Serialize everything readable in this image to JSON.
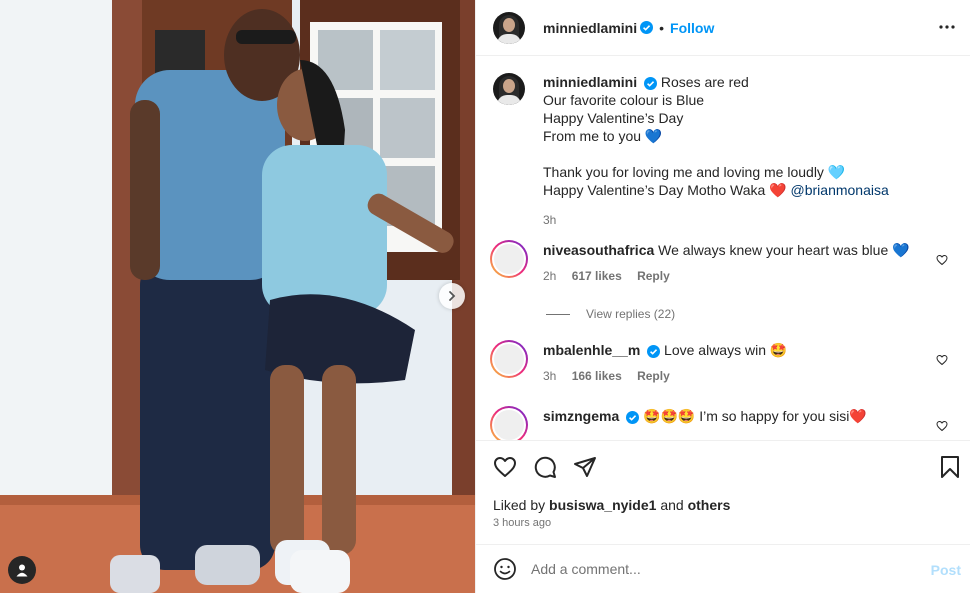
{
  "post": {
    "username": "minniedlamini",
    "follow_label": "Follow",
    "separator": "•",
    "more_icon": "more-horizontal-icon"
  },
  "caption": {
    "username": "minniedlamini",
    "lines": [
      "Roses are red",
      "Our favorite colour is Blue",
      "Happy Valentine’s Day",
      "From me to you 💙",
      "",
      "Thank you for loving me and loving me loudly 🩵",
      "Happy Valentine’s Day Motho Waka ❤️"
    ],
    "mention": "@brianmonaisa",
    "time": "3h"
  },
  "comments": [
    {
      "username": "niveasouthafrica",
      "text": "We always knew your heart was blue 💙",
      "time": "2h",
      "likes": "617 likes",
      "reply_label": "Reply"
    },
    {
      "username": "mbalenhle__m",
      "text": "Love always win 🤩",
      "time": "3h",
      "likes": "166 likes",
      "reply_label": "Reply"
    },
    {
      "username": "simzngema",
      "text": "🤩🤩🤩 I’m so happy for you sisi❤️"
    }
  ],
  "view_replies": "View replies (22)",
  "footer": {
    "liked_prefix": "Liked by",
    "liked_user": "busiswa_nyide1",
    "liked_and": "and",
    "liked_others": "others",
    "posted_ago": "3 hours ago"
  },
  "add_comment": {
    "placeholder": "Add a comment...",
    "post_label": "Post"
  },
  "colors": {
    "accent": "#0095f6",
    "verified": "#0095f6",
    "post_disabled": "#b2dffc"
  }
}
